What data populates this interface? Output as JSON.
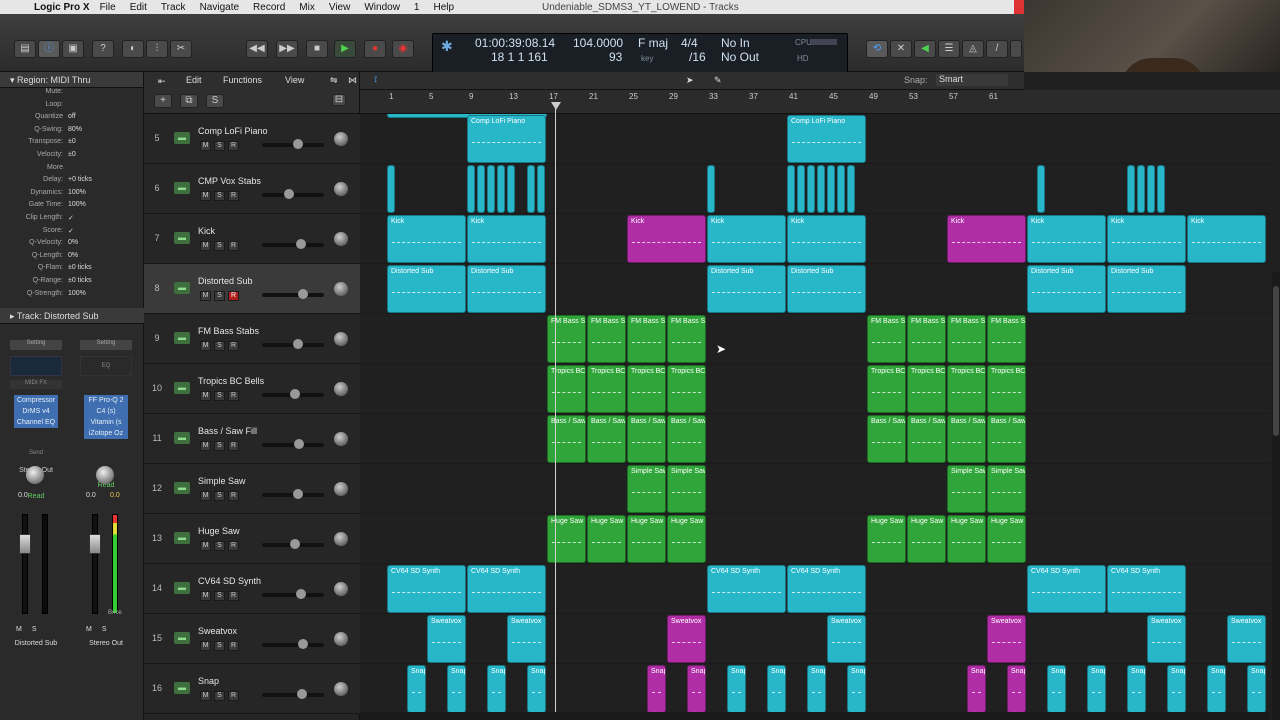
{
  "menubar": {
    "app": "Logic Pro X",
    "items": [
      "File",
      "Edit",
      "Track",
      "Navigate",
      "Record",
      "Mix",
      "View",
      "Window",
      "1",
      "Help"
    ],
    "window_title": "Undeniable_SDMS3_YT_LOWEND - Tracks"
  },
  "lcd": {
    "time": "01:00:39:08.14",
    "bars": "18  1  1  161",
    "tempo": "104.0000",
    "tempo_sub": "93",
    "key": "F maj",
    "key_sub": "key",
    "signature": "4/4",
    "division": "/16",
    "in": "No In",
    "out": "No Out",
    "cpu_label": "CPU",
    "hd_label": "HD"
  },
  "inspector": {
    "region_title": "Region: MIDI Thru",
    "params": [
      {
        "k": "Mute:",
        "v": ""
      },
      {
        "k": "Loop:",
        "v": ""
      },
      {
        "k": "Quantize",
        "v": "off"
      },
      {
        "k": "Q-Swing:",
        "v": "80%"
      },
      {
        "k": "Transpose:",
        "v": "±0"
      },
      {
        "k": "Velocity:",
        "v": "±0"
      },
      {
        "k": "More",
        "v": ""
      },
      {
        "k": "Delay:",
        "v": "+0 ticks"
      },
      {
        "k": "Dynamics:",
        "v": "100%"
      },
      {
        "k": "Gate Time:",
        "v": "100%"
      },
      {
        "k": "Clip Length:",
        "v": "✓"
      },
      {
        "k": "Score:",
        "v": "✓"
      },
      {
        "k": "Q-Velocity:",
        "v": "0%"
      },
      {
        "k": "Q-Length:",
        "v": "0%"
      },
      {
        "k": "Q-Flam:",
        "v": "±0 ticks"
      },
      {
        "k": "Q-Range:",
        "v": "±0 ticks"
      },
      {
        "k": "Q-Strength:",
        "v": "100%"
      }
    ],
    "track_title": "Track:  Distorted Sub",
    "strip_left": {
      "setting": "Setting",
      "midi_fx": "MIDI FX",
      "plugins": [
        "Compressor",
        "DrMS v4",
        "Channel EQ"
      ],
      "send": "Send",
      "output": "Stereo Out",
      "automation": "Read",
      "value": "0.0",
      "name": "Distorted Sub"
    },
    "strip_right": {
      "setting": "Setting",
      "eq": "EQ",
      "plugins": [
        "FF Pro-Q 2",
        "C4 (s)",
        "Vitamin (s",
        "iZotope Oz"
      ],
      "automation": "Read",
      "value": "0.0",
      "value2": "0.0",
      "bounce": "Bnce",
      "name": "Stereo Out"
    }
  },
  "arrange_toolbar": {
    "edit": "Edit",
    "functions": "Functions",
    "view": "View",
    "snap_label": "Snap:",
    "snap_value": "Smart"
  },
  "ruler": [
    "1",
    "5",
    "9",
    "13",
    "17",
    "21",
    "25",
    "29",
    "33",
    "37",
    "41",
    "45",
    "49",
    "53",
    "57",
    "61"
  ],
  "colors": {
    "cyan": "#27b7c9",
    "green": "#2fa53a",
    "magenta": "#b02da6",
    "playhead": "#cfcfcf"
  },
  "tracks": [
    {
      "num": "5",
      "name": "Comp LoFi Piano",
      "icon": "synth-icon",
      "vol": 0.55
    },
    {
      "num": "6",
      "name": "CMP Vox Stabs",
      "icon": "synth-icon",
      "vol": 0.4
    },
    {
      "num": "7",
      "name": "Kick",
      "icon": "drum-icon",
      "vol": 0.6
    },
    {
      "num": "8",
      "name": "Distorted Sub",
      "icon": "synth-icon",
      "vol": 0.65,
      "selected": true,
      "record": true
    },
    {
      "num": "9",
      "name": "FM Bass Stabs",
      "icon": "synth-icon",
      "vol": 0.55
    },
    {
      "num": "10",
      "name": "Tropics BC Bells",
      "icon": "synth-icon",
      "vol": 0.5
    },
    {
      "num": "11",
      "name": "Bass / Saw Fill",
      "icon": "synth-icon",
      "vol": 0.58
    },
    {
      "num": "12",
      "name": "Simple Saw",
      "icon": "synth-icon",
      "vol": 0.55
    },
    {
      "num": "13",
      "name": "Huge Saw",
      "icon": "synth-icon",
      "vol": 0.5
    },
    {
      "num": "14",
      "name": "CV64 SD Synth",
      "icon": "synth-icon",
      "vol": 0.6
    },
    {
      "num": "15",
      "name": "Sweatvox",
      "icon": "synth-icon",
      "vol": 0.65
    },
    {
      "num": "16",
      "name": "Snap",
      "icon": "synth-icon",
      "vol": 0.62
    }
  ]
}
